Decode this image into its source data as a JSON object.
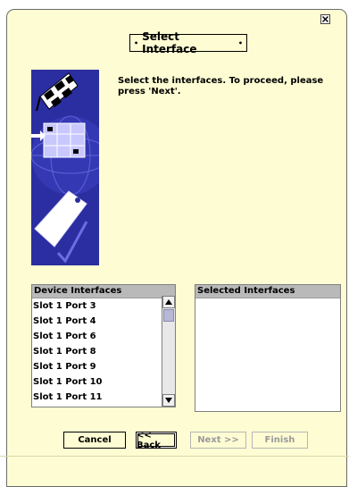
{
  "dialog": {
    "title": "Select Interface",
    "instructions": "Select the interfaces. To proceed, please press 'Next'."
  },
  "device_interfaces": {
    "header": "Device Interfaces",
    "items": [
      "Slot 1 Port 3",
      "Slot 1 Port 4",
      "Slot 1 Port 6",
      "Slot 1 Port 8",
      "Slot 1 Port 9",
      "Slot 1 Port 10",
      "Slot 1 Port 11"
    ]
  },
  "selected_interfaces": {
    "header": "Selected Interfaces",
    "items": []
  },
  "buttons": {
    "cancel": "Cancel",
    "back": "<< Back",
    "next": "Next >>",
    "finish": "Finish"
  },
  "colors": {
    "background": "#fdfcd3",
    "banner": "#2b2ea0",
    "header": "#b9b9b9"
  },
  "icons": {
    "close": "close-icon",
    "banner": "wizard-banner-graphic"
  }
}
